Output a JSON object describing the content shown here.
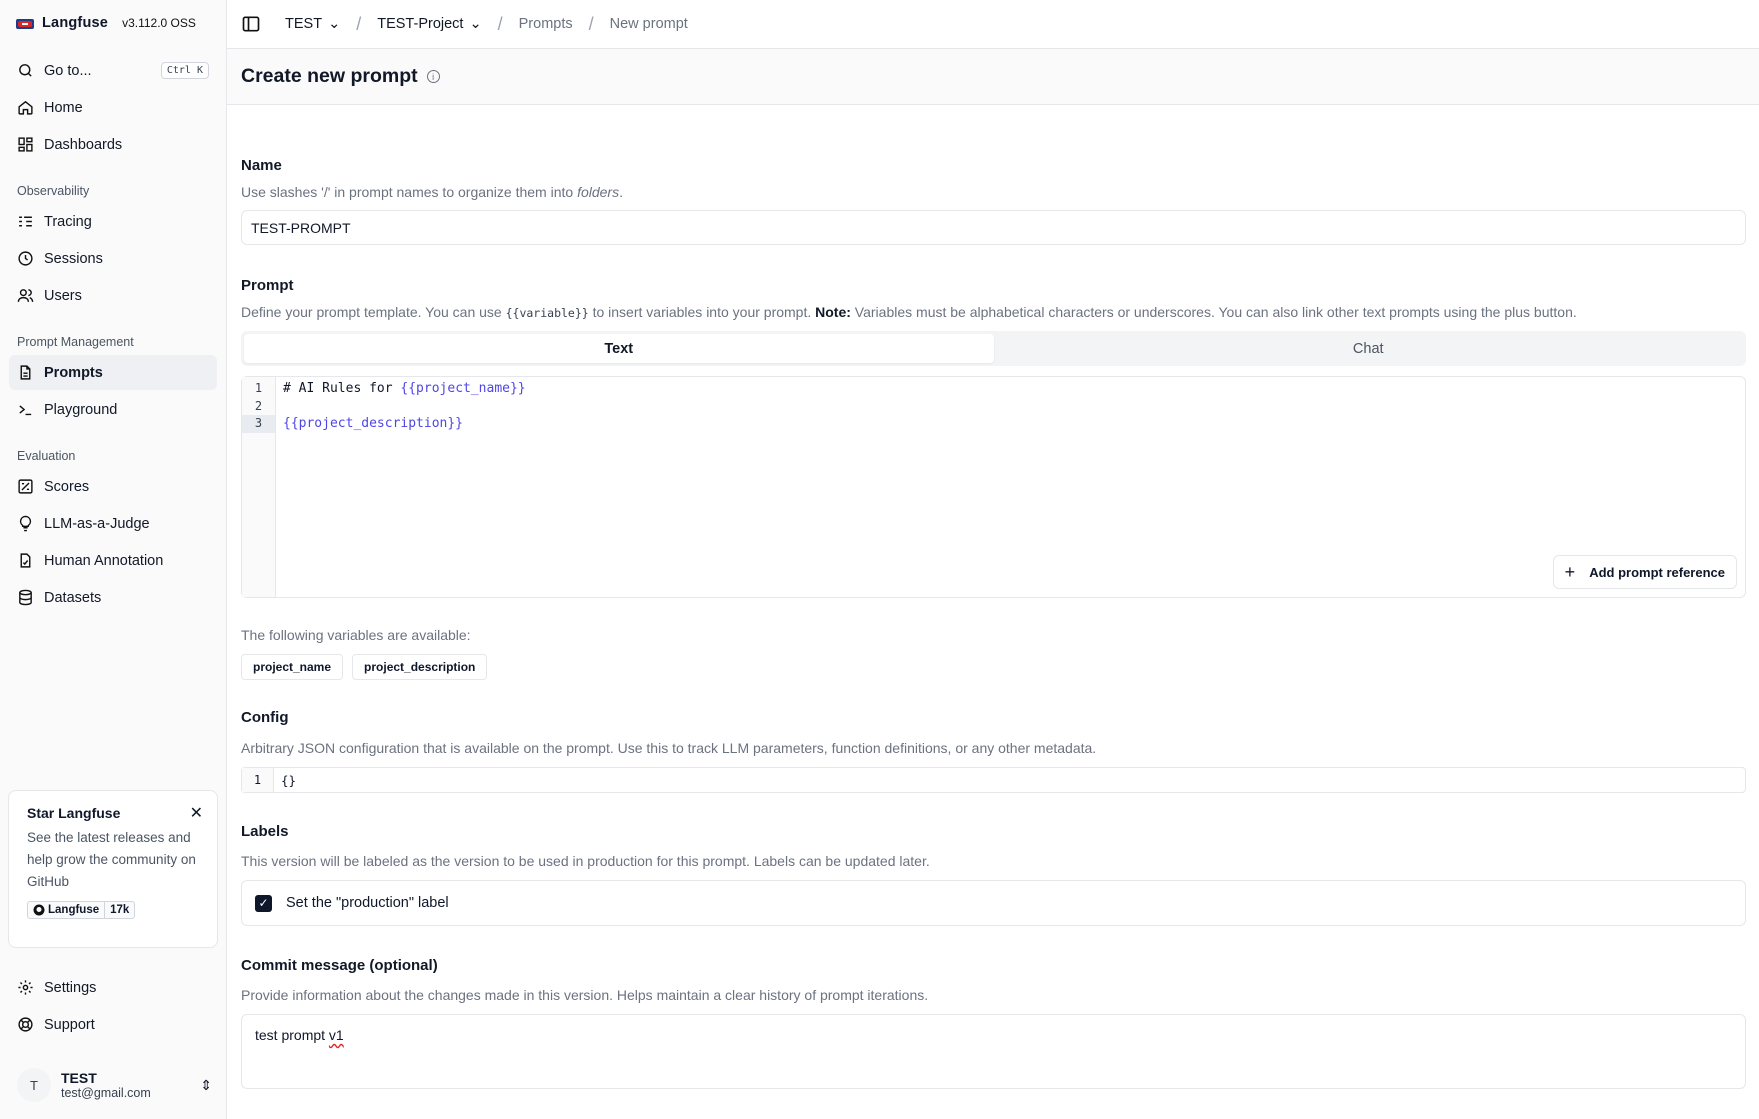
{
  "sidebar": {
    "brand": "Langfuse",
    "version": "v3.112.0 OSS",
    "goto": {
      "label": "Go to...",
      "shortcut": "Ctrl K"
    },
    "home": "Home",
    "dashboards": "Dashboards",
    "section_observability": "Observability",
    "tracing": "Tracing",
    "sessions": "Sessions",
    "users": "Users",
    "section_prompt_mgmt": "Prompt Management",
    "prompts": "Prompts",
    "playground": "Playground",
    "section_evaluation": "Evaluation",
    "scores": "Scores",
    "llm_judge": "LLM-as-a-Judge",
    "human_annotation": "Human Annotation",
    "datasets": "Datasets",
    "star_card": {
      "title": "Star Langfuse",
      "text": "See the latest releases and help grow the community on GitHub",
      "gh_label": "Langfuse",
      "gh_count": "17k"
    },
    "settings": "Settings",
    "support": "Support",
    "user": {
      "initial": "T",
      "name": "TEST",
      "email": "test@gmail.com"
    }
  },
  "topbar": {
    "org": "TEST",
    "project": "TEST-Project",
    "crumb_prompts": "Prompts",
    "crumb_new": "New prompt"
  },
  "page": {
    "title": "Create new prompt"
  },
  "form": {
    "name_label": "Name",
    "name_desc_pre": "Use slashes '/' in prompt names to organize them into ",
    "name_desc_em": "folders",
    "name_desc_post": ".",
    "name_value": "TEST-PROMPT",
    "prompt_label": "Prompt",
    "prompt_desc_1": "Define your prompt template. You can use ",
    "prompt_desc_code": "{{variable}}",
    "prompt_desc_2": " to insert variables into your prompt. ",
    "prompt_desc_note": "Note:",
    "prompt_desc_3": " Variables must be alphabetical characters or underscores. You can also link other text prompts using the plus button.",
    "tab_text": "Text",
    "tab_chat": "Chat",
    "code_line1_prefix": "# AI Rules for ",
    "code_line1_var": "{{project_name}}",
    "code_line3_var": "{{project_description}}",
    "line_numbers": [
      "1",
      "2",
      "3"
    ],
    "add_ref": "Add prompt reference",
    "vars_desc": "The following variables are available:",
    "variables": [
      "project_name",
      "project_description"
    ],
    "config_label": "Config",
    "config_desc": "Arbitrary JSON configuration that is available on the prompt. Use this to track LLM parameters, function definitions, or any other metadata.",
    "config_line": "1",
    "config_value": "{}",
    "labels_label": "Labels",
    "labels_desc": "This version will be labeled as the version to be used in production for this prompt. Labels can be updated later.",
    "production_label": "Set the \"production\" label",
    "commit_label": "Commit message (optional)",
    "commit_desc": "Provide information about the changes made in this version. Helps maintain a clear history of prompt iterations.",
    "commit_value_a": "test prompt ",
    "commit_value_b": "v1"
  }
}
